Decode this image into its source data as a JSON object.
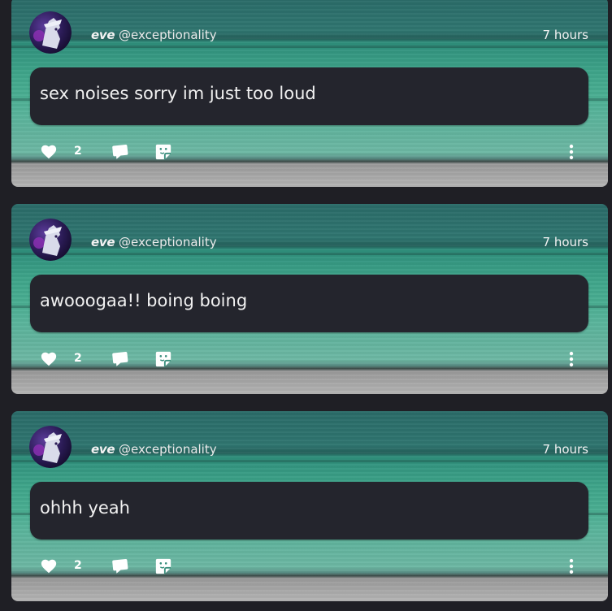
{
  "posts": [
    {
      "display_name": "eve",
      "handle": "@exceptionality",
      "time": "7 hours",
      "text": "sex noises sorry im just too loud",
      "like_count": "2"
    },
    {
      "display_name": "eve",
      "handle": "@exceptionality",
      "time": "7 hours",
      "text": "awooogaa!! boing boing",
      "like_count": "2"
    },
    {
      "display_name": "eve",
      "handle": "@exceptionality",
      "time": "7 hours",
      "text": "ohhh yeah",
      "like_count": "2"
    }
  ],
  "icons": {
    "like": "heart-icon",
    "reply": "speech-bubble-icon",
    "react": "sticker-icon",
    "more": "vertical-ellipsis-icon"
  },
  "colors": {
    "background": "#1f1f25",
    "bubble": "#24252d",
    "banner_teal": "#2f7670",
    "banner_green": "#4aae92",
    "text": "#f2f2f2"
  }
}
